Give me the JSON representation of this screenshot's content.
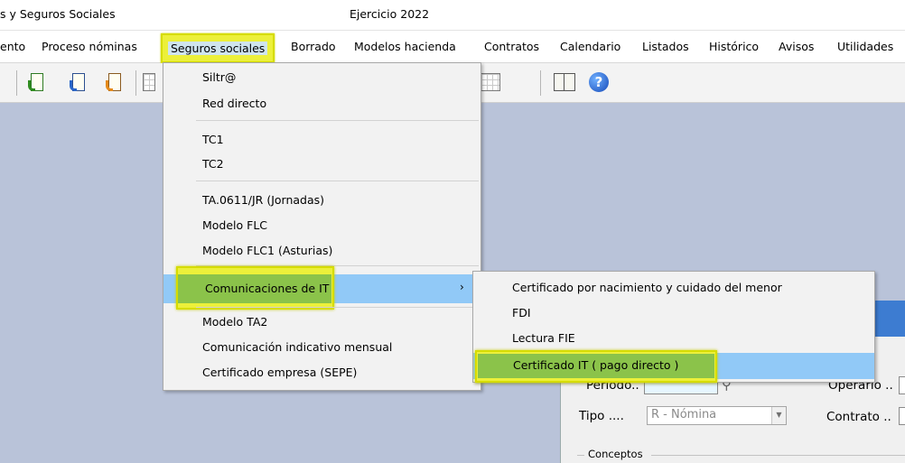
{
  "window": {
    "title_left": "s y Seguros Sociales",
    "title_center": "Ejercicio 2022"
  },
  "menubar": {
    "items": [
      {
        "label": "ento"
      },
      {
        "label": "Proceso nóminas"
      },
      {
        "label": "Seguros sociales"
      },
      {
        "label": "Borrado"
      },
      {
        "label": "Modelos hacienda"
      },
      {
        "label": "Contratos"
      },
      {
        "label": "Calendario"
      },
      {
        "label": "Listados"
      },
      {
        "label": "Histórico"
      },
      {
        "label": "Avisos"
      },
      {
        "label": "Utilidades"
      }
    ]
  },
  "toolbar": {
    "icons": [
      "import-green-icon",
      "import-blue-icon",
      "import-orange-icon",
      "calculator-icon",
      "grid-icon",
      "book-icon",
      "help-icon"
    ],
    "help_glyph": "?"
  },
  "seguros_menu": {
    "items": [
      {
        "label": "Siltr@"
      },
      {
        "label": "Red directo"
      },
      {
        "label": "TC1"
      },
      {
        "label": "TC2"
      },
      {
        "label": "TA.0611/JR (Jornadas)"
      },
      {
        "label": "Modelo FLC"
      },
      {
        "label": "Modelo FLC1 (Asturias)"
      },
      {
        "label": "Comunicaciones de IT"
      },
      {
        "label": "Modelo TA2"
      },
      {
        "label": "Comunicación indicativo mensual"
      },
      {
        "label": "Certificado empresa (SEPE)"
      }
    ],
    "submenu_arrow": "›"
  },
  "it_submenu": {
    "items": [
      {
        "label": "Certificado por nacimiento y cuidado del menor"
      },
      {
        "label": "FDI"
      },
      {
        "label": "Lectura FIE"
      },
      {
        "label": "Certificado IT ( pago directo )"
      }
    ]
  },
  "form": {
    "periodo_label": "Período..",
    "operario_label": "Operario ..",
    "tipo_label": "Tipo ....",
    "tipo_value": "R - Nómina",
    "contrato_label": "Contrato ..",
    "conceptos_label": "Conceptos"
  },
  "colors": {
    "highlight_yellow": "#ecf03a",
    "highlight_green": "#8bc34a",
    "selection_blue": "#91c9f7",
    "panel_header": "#3d7cd1"
  }
}
